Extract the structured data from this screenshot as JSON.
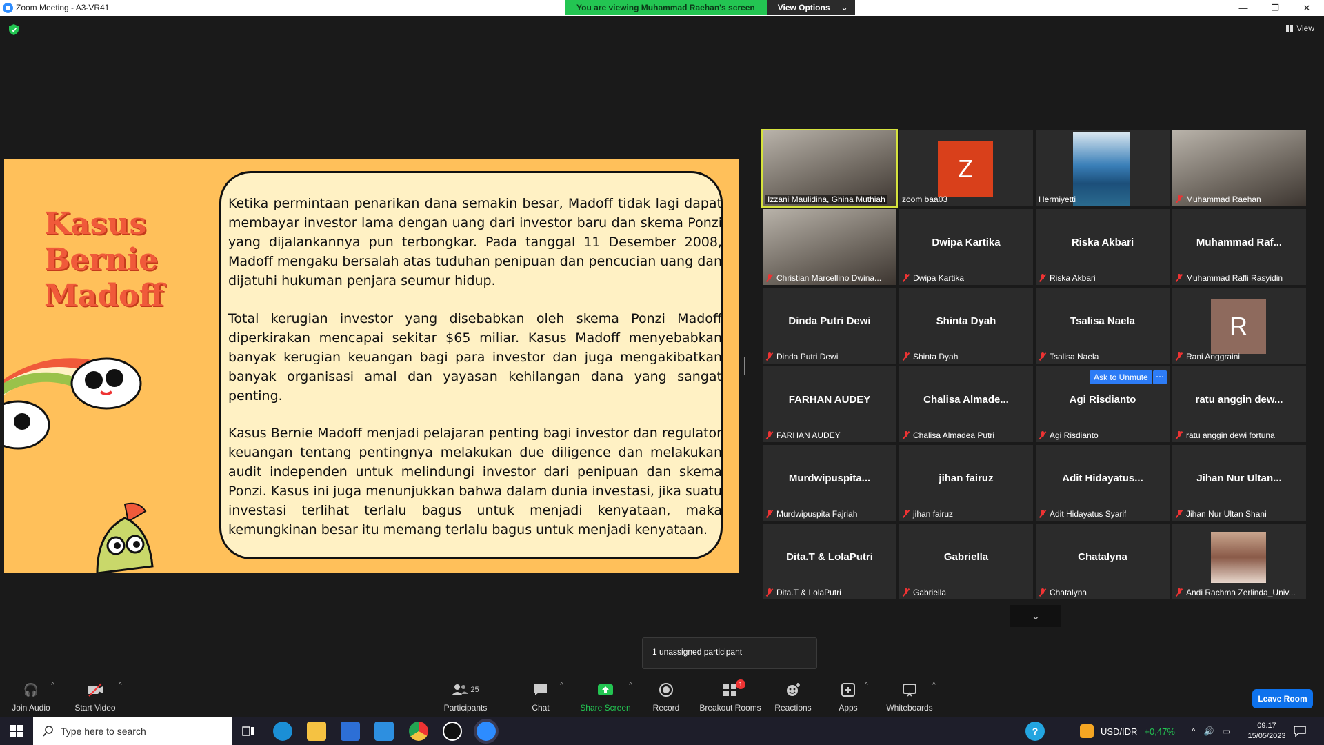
{
  "window": {
    "title": "Zoom Meeting - A3-VR41"
  },
  "banner": {
    "message": "You are viewing Muhammad Raehan's screen",
    "options_label": "View Options"
  },
  "view_button": {
    "label": "View"
  },
  "slide": {
    "title_lines": [
      "Kasus",
      "Bernie",
      "Madoff"
    ],
    "paragraphs": [
      "Ketika permintaan penarikan dana semakin besar, Madoff tidak lagi dapat membayar investor lama dengan uang dari investor baru dan skema Ponzi yang dijalankannya pun terbongkar. Pada tanggal 11 Desember 2008, Madoff mengaku bersalah atas tuduhan penipuan dan pencucian uang dan dijatuhi hukuman penjara seumur hidup.",
      "Total kerugian investor yang disebabkan oleh skema Ponzi Madoff diperkirakan mencapai sekitar $65 miliar. Kasus Madoff menyebabkan banyak kerugian keuangan bagi para investor dan juga mengakibatkan banyak organisasi amal dan yayasan kehilangan dana yang sangat penting.",
      "Kasus Bernie Madoff menjadi pelajaran penting bagi investor dan regulator keuangan tentang pentingnya melakukan due diligence dan melakukan audit independen untuk melindungi investor dari penipuan dan skema Ponzi. Kasus ini juga menunjukkan bahwa dalam dunia investasi, jika suatu investasi terlihat terlalu bagus untuk menjadi kenyataan, maka kemungkinan besar itu memang terlalu bagus untuk menjadi kenyataan."
    ]
  },
  "participants": [
    {
      "label": "Izzani Maulidina, Ghina Muthiah",
      "big": "",
      "kind": "video",
      "muted": false,
      "active": true
    },
    {
      "label": "zoom baa03",
      "big": "",
      "kind": "avatar",
      "avatar_letter": "Z",
      "avatar_color": "#d9401b",
      "muted": false
    },
    {
      "label": "Hermiyetti",
      "big": "",
      "kind": "photo",
      "muted": false
    },
    {
      "label": "Muhammad Raehan",
      "big": "",
      "kind": "video",
      "muted": true
    },
    {
      "label": "Christian Marcellino Dwina...",
      "big": "",
      "kind": "video",
      "muted": true
    },
    {
      "label": "Dwipa Kartika",
      "big": "Dwipa Kartika",
      "kind": "name",
      "muted": true
    },
    {
      "label": "Riska Akbari",
      "big": "Riska Akbari",
      "kind": "name",
      "muted": true
    },
    {
      "label": "Muhammad Rafli Rasyidin",
      "big": "Muhammad Raf...",
      "kind": "name",
      "muted": true
    },
    {
      "label": "Dinda Putri Dewi",
      "big": "Dinda Putri Dewi",
      "kind": "name",
      "muted": true
    },
    {
      "label": "Shinta Dyah",
      "big": "Shinta Dyah",
      "kind": "name",
      "muted": true
    },
    {
      "label": "Tsalisa Naela",
      "big": "Tsalisa Naela",
      "kind": "name",
      "muted": true
    },
    {
      "label": "Rani Anggraini",
      "big": "",
      "kind": "avatar",
      "avatar_letter": "R",
      "avatar_color": "#8e6a5d",
      "muted": true
    },
    {
      "label": "FARHAN AUDEY",
      "big": "FARHAN AUDEY",
      "kind": "name",
      "muted": true
    },
    {
      "label": "Chalisa Almadea Putri",
      "big": "Chalisa Almade...",
      "kind": "name",
      "muted": true
    },
    {
      "label": "Agi Risdianto",
      "big": "Agi Risdianto",
      "kind": "name",
      "muted": true
    },
    {
      "label": "ratu anggin dewi fortuna",
      "big": "ratu anggin dew...",
      "kind": "name",
      "muted": true
    },
    {
      "label": "Murdwipuspita Fajriah",
      "big": "Murdwipuspita...",
      "kind": "name",
      "muted": true
    },
    {
      "label": "jihan fairuz",
      "big": "jihan fairuz",
      "kind": "name",
      "muted": true
    },
    {
      "label": "Adit Hidayatus Syarif",
      "big": "Adit Hidayatus...",
      "kind": "name",
      "muted": true
    },
    {
      "label": "Jihan Nur Ultan Shani",
      "big": "Jihan Nur Ultan...",
      "kind": "name",
      "muted": true
    },
    {
      "label": "Dita.T & LolaPutri",
      "big": "Dita.T & LolaPutri",
      "kind": "name",
      "muted": true
    },
    {
      "label": "Gabriella",
      "big": "Gabriella",
      "kind": "name",
      "muted": true
    },
    {
      "label": "Chatalyna",
      "big": "Chatalyna",
      "kind": "name",
      "muted": true
    },
    {
      "label": "Andi Rachma Zerlinda_Univ...",
      "big": "",
      "kind": "photo2",
      "muted": true
    }
  ],
  "hover_actions": {
    "ask_unmute": "Ask to Unmute",
    "more": "···"
  },
  "tooltip": {
    "text": "1 unassigned participant"
  },
  "toolbar": {
    "join_audio": "Join Audio",
    "start_video": "Start Video",
    "participants": "Participants",
    "participants_count": "25",
    "chat": "Chat",
    "share_screen": "Share Screen",
    "record": "Record",
    "breakout_rooms": "Breakout Rooms",
    "breakout_badge": "1",
    "reactions": "Reactions",
    "apps": "Apps",
    "whiteboards": "Whiteboards",
    "leave_room": "Leave Room"
  },
  "taskbar": {
    "search_placeholder": "Type here to search",
    "currency": "USD/IDR",
    "currency_change": "+0,47%",
    "time": "09.17",
    "date": "15/05/2023"
  }
}
